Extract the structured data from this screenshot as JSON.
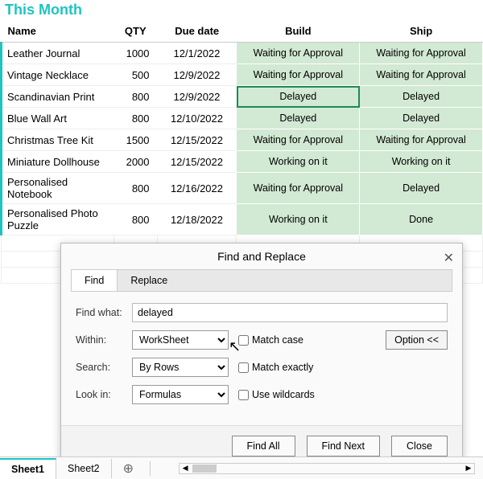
{
  "title": "This Month",
  "columns": {
    "name": "Name",
    "qty": "QTY",
    "due": "Due date",
    "build": "Build",
    "ship": "Ship"
  },
  "rows": [
    {
      "name": "Leather Journal",
      "qty": "1000",
      "due": "12/1/2022",
      "build": "Waiting for Approval",
      "ship": "Waiting for Approval"
    },
    {
      "name": "Vintage Necklace",
      "qty": "500",
      "due": "12/9/2022",
      "build": "Waiting for Approval",
      "ship": "Waiting for Approval"
    },
    {
      "name": "Scandinavian Print",
      "qty": "800",
      "due": "12/9/2022",
      "build": "Delayed",
      "ship": "Delayed",
      "selected": true
    },
    {
      "name": "Blue Wall Art",
      "qty": "800",
      "due": "12/10/2022",
      "build": "Delayed",
      "ship": "Delayed"
    },
    {
      "name": "Christmas Tree Kit",
      "qty": "1500",
      "due": "12/15/2022",
      "build": "Waiting for Approval",
      "ship": "Waiting for Approval"
    },
    {
      "name": "Miniature Dollhouse",
      "qty": "2000",
      "due": "12/15/2022",
      "build": "Working on it",
      "ship": "Working on it"
    },
    {
      "name": "Personalised Notebook",
      "qty": "800",
      "due": "12/16/2022",
      "build": "Waiting for Approval",
      "ship": "Delayed"
    },
    {
      "name": "Personalised Photo Puzzle",
      "qty": "800",
      "due": "12/18/2022",
      "build": "Working on it",
      "ship": "Done"
    }
  ],
  "dialog": {
    "title": "Find and Replace",
    "tabs": {
      "find": "Find",
      "replace": "Replace"
    },
    "find_what_label": "Find what:",
    "find_what_value": "delayed",
    "within_label": "Within:",
    "within_value": "WorkSheet",
    "search_label": "Search:",
    "search_value": "By Rows",
    "lookin_label": "Look in:",
    "lookin_value": "Formulas",
    "match_case": "Match case",
    "match_exactly": "Match exactly",
    "use_wildcards": "Use wildcards",
    "option_btn": "Option <<",
    "find_all": "Find All",
    "find_next": "Find Next",
    "close": "Close"
  },
  "sheetbar": {
    "sheet1": "Sheet1",
    "sheet2": "Sheet2",
    "add": "⊕"
  }
}
